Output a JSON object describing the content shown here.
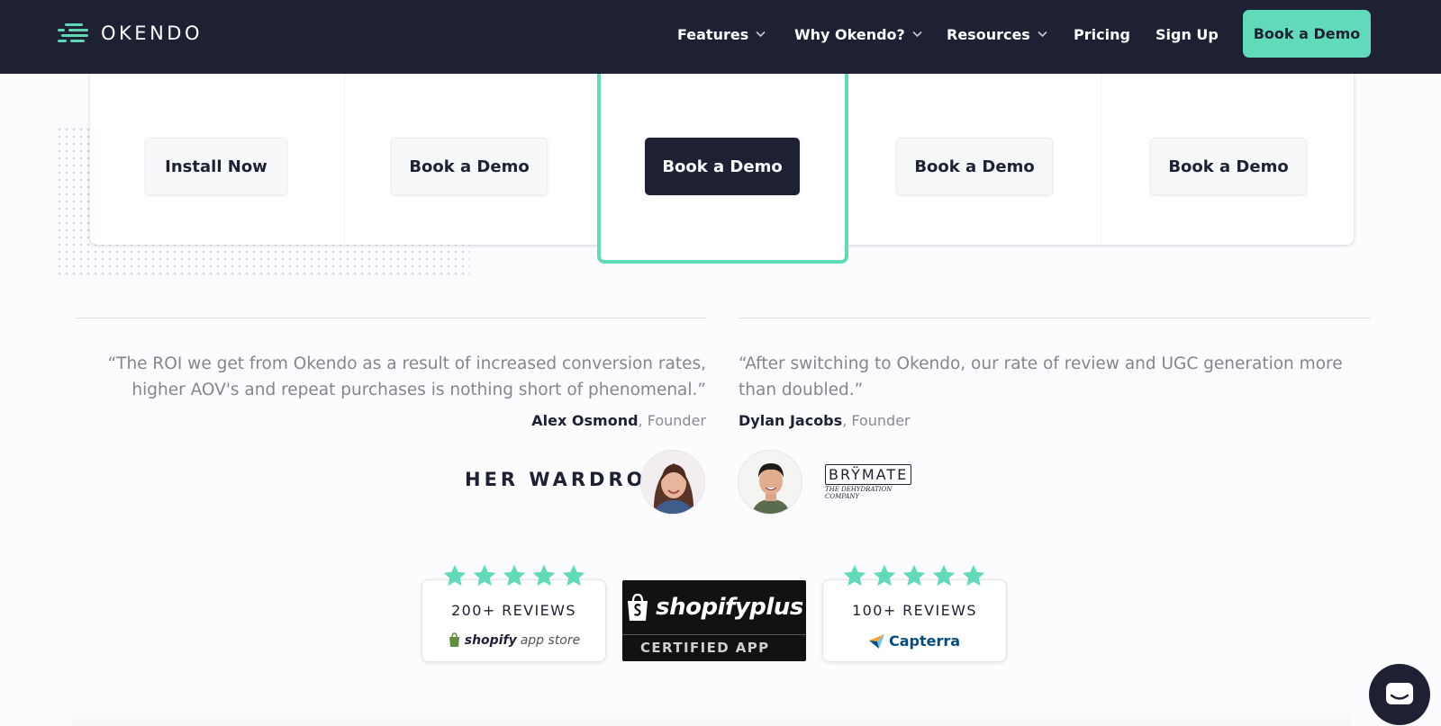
{
  "nav": {
    "logo_text": "OKENDO",
    "items": [
      {
        "label": "Features",
        "has_dropdown": true
      },
      {
        "label": "Why Okendo?",
        "has_dropdown": true
      },
      {
        "label": "Resources",
        "has_dropdown": true
      },
      {
        "label": "Pricing",
        "has_dropdown": false
      },
      {
        "label": "Sign Up",
        "has_dropdown": false
      }
    ],
    "cta_label": "Book a Demo"
  },
  "plans": {
    "buttons": [
      "Install Now",
      "Book a Demo",
      "Book a Demo",
      "Book a Demo",
      "Book a Demo"
    ],
    "featured_index": 2
  },
  "testimonials": [
    {
      "quote": "“The ROI we get from Okendo as a result of increased conversion rates, higher AOV's and repeat purchases is nothing short of phenomenal.”",
      "name": "Alex Osmond",
      "role": ", Founder",
      "brand": "HER WARDROBE"
    },
    {
      "quote": "“After switching to Okendo, our rate of review and UGC generation more than doubled.”",
      "name": "Dylan Jacobs",
      "role": ", Founder",
      "brand": "BRŸMATE",
      "brand_tagline": "THE DEHYDRATION COMPANY"
    }
  ],
  "badges": {
    "shopify_reviews": {
      "count": "200+ REVIEWS",
      "source_bold": "shopify",
      "source_light": "app store",
      "stars": 5
    },
    "shopify_plus": {
      "wordmark": "shopifyplus",
      "subtitle": "CERTIFIED APP"
    },
    "capterra_reviews": {
      "count": "100+ REVIEWS",
      "source": "Capterra",
      "stars": 5
    }
  },
  "colors": {
    "nav_bg": "#1d2133",
    "accent": "#60dab8",
    "text_dark": "#1d2133",
    "text_muted": "#85848f"
  }
}
